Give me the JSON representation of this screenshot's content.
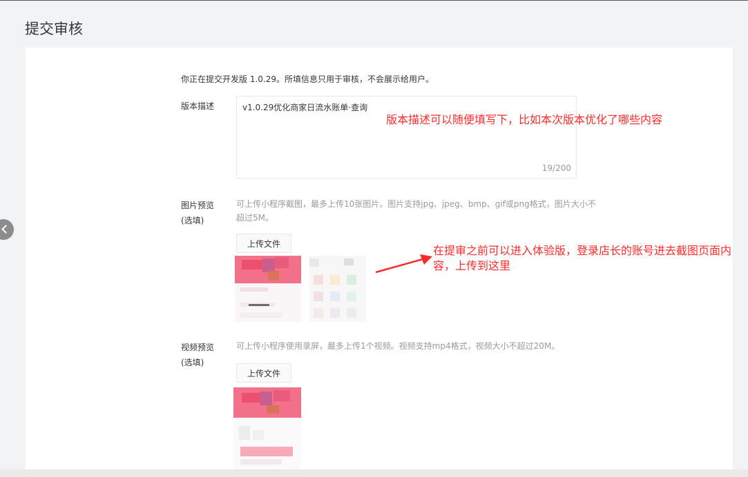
{
  "page": {
    "title": "提交审核"
  },
  "form": {
    "intro": "你正在提交开发版 1.0.29。所填信息只用于审核，不会展示给用户。",
    "version_desc": {
      "label": "版本描述",
      "value": "v1.0.29优化商家日流水账单·查询",
      "counter": "19/200"
    },
    "image_preview": {
      "label_line1": "图片预览",
      "label_line2": "(选填)",
      "hint_line1": "可上传小程序截图，最多上传10张图片。图片支持jpg、jpeg、bmp、gif或png格式，图片大小不",
      "hint_line2": "超过5M。",
      "upload_label": "上传文件"
    },
    "video_preview": {
      "label_line1": "视频预览",
      "label_line2": "(选填)",
      "hint": "可上传小程序使用录屏，最多上传1个视频。视频支持mp4格式，视频大小不超过20M。",
      "upload_label": "上传文件"
    }
  },
  "annotations": {
    "desc_note": "版本描述可以随便填写下，比如本次版本优化了哪些内容",
    "screenshot_note_line1": "在提审之前可以进入体验版，登录店长的账号进去截图页面内",
    "screenshot_note_line2": "容，上传到这里"
  },
  "colors": {
    "annotation_red": "#ff2a2a",
    "thumb_pink": "#f0526e"
  },
  "icons": {
    "nav_prev": "chevron-left-icon"
  }
}
